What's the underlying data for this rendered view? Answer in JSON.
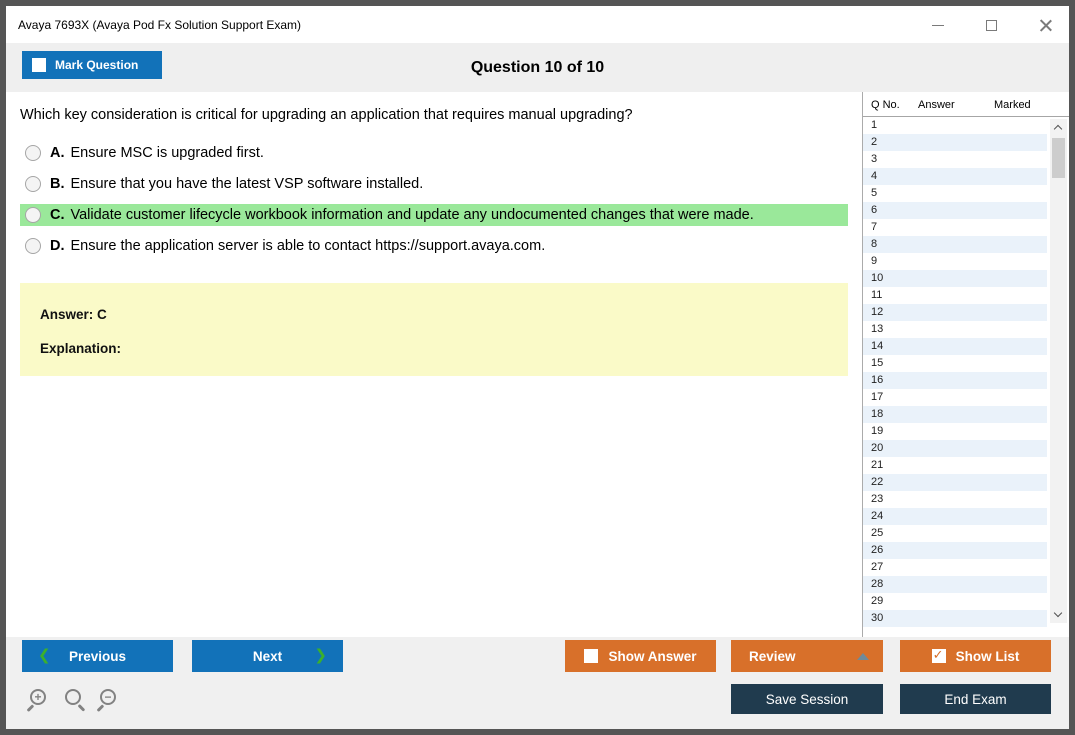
{
  "window": {
    "title": "Avaya 7693X (Avaya Pod Fx Solution Support Exam)"
  },
  "toolbar": {
    "mark_question_label": "Mark Question",
    "question_counter": "Question 10 of 10"
  },
  "question": {
    "text": "Which key consideration is critical for upgrading an application that requires manual upgrading?",
    "options": [
      {
        "letter": "A.",
        "text": "Ensure MSC is upgraded first.",
        "highlighted": false
      },
      {
        "letter": "B.",
        "text": "Ensure that you have the latest VSP software installed.",
        "highlighted": false
      },
      {
        "letter": "C.",
        "text": "Validate customer lifecycle workbook information and update any undocumented changes that were made.",
        "highlighted": true
      },
      {
        "letter": "D.",
        "text": "Ensure the application server is able to contact https://support.avaya.com.",
        "highlighted": false
      }
    ]
  },
  "answer_box": {
    "answer_label": "Answer: C",
    "explanation_label": "Explanation:"
  },
  "question_list": {
    "headers": [
      "Q No.",
      "Answer",
      "Marked"
    ],
    "rows": [
      "1",
      "2",
      "3",
      "4",
      "5",
      "6",
      "7",
      "8",
      "9",
      "10",
      "11",
      "12",
      "13",
      "14",
      "15",
      "16",
      "17",
      "18",
      "19",
      "20",
      "21",
      "22",
      "23",
      "24",
      "25",
      "26",
      "27",
      "28",
      "29",
      "30"
    ]
  },
  "footer": {
    "previous_label": "Previous",
    "next_label": "Next",
    "show_answer_label": "Show Answer",
    "review_label": "Review",
    "show_list_label": "Show List",
    "save_session_label": "Save Session",
    "end_exam_label": "End Exam"
  },
  "colors": {
    "blue": "#1272B9",
    "orange": "#D8702A",
    "navy": "#203B4E",
    "highlight_green": "#9AE89A",
    "answer_yellow": "#FAFAC8",
    "alt_row_blue": "#EAF2FA",
    "chevron_green": "#3CB02C",
    "window_border": "#555555",
    "toolbar_bg": "#EFEFEF",
    "footer_bg": "#F0F0F0"
  }
}
